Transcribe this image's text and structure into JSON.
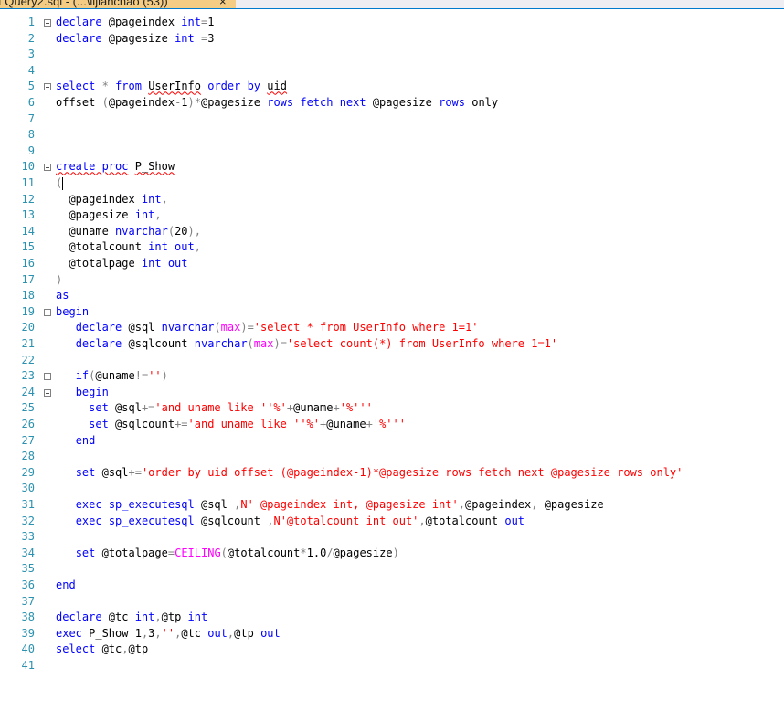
{
  "tab": {
    "title": "LQuery2.sql - (...\\lijianchao (53))",
    "close": "×"
  },
  "lines": [
    {
      "n": "1",
      "fold": true,
      "t": [
        {
          "c": "k",
          "v": "declare"
        },
        {
          "c": "n",
          "v": " @pageindex "
        },
        {
          "c": "k",
          "v": "int"
        },
        {
          "c": "g",
          "v": "="
        },
        {
          "c": "n",
          "v": "1"
        }
      ]
    },
    {
      "n": "2",
      "t": [
        {
          "c": "k",
          "v": "declare"
        },
        {
          "c": "n",
          "v": " @pagesize "
        },
        {
          "c": "k",
          "v": "int"
        },
        {
          "c": "n",
          "v": " "
        },
        {
          "c": "g",
          "v": "="
        },
        {
          "c": "n",
          "v": "3"
        }
      ]
    },
    {
      "n": "3",
      "t": []
    },
    {
      "n": "4",
      "t": []
    },
    {
      "n": "5",
      "fold": true,
      "t": [
        {
          "c": "k",
          "v": "select"
        },
        {
          "c": "n",
          "v": " "
        },
        {
          "c": "g",
          "v": "*"
        },
        {
          "c": "n",
          "v": " "
        },
        {
          "c": "k",
          "v": "from"
        },
        {
          "c": "n",
          "v": " "
        },
        {
          "c": "n squig",
          "v": "UserInfo"
        },
        {
          "c": "n",
          "v": " "
        },
        {
          "c": "k",
          "v": "order by"
        },
        {
          "c": "n",
          "v": " "
        },
        {
          "c": "n squig",
          "v": "uid"
        }
      ]
    },
    {
      "n": "6",
      "t": [
        {
          "c": "n",
          "v": "offset "
        },
        {
          "c": "g",
          "v": "("
        },
        {
          "c": "n",
          "v": "@pageindex"
        },
        {
          "c": "g",
          "v": "-"
        },
        {
          "c": "n",
          "v": "1"
        },
        {
          "c": "g",
          "v": ")*"
        },
        {
          "c": "n",
          "v": "@pagesize "
        },
        {
          "c": "k",
          "v": "rows fetch next"
        },
        {
          "c": "n",
          "v": " @pagesize "
        },
        {
          "c": "k",
          "v": "rows"
        },
        {
          "c": "n",
          "v": " only"
        }
      ]
    },
    {
      "n": "7",
      "t": []
    },
    {
      "n": "8",
      "t": []
    },
    {
      "n": "9",
      "t": []
    },
    {
      "n": "10",
      "fold": true,
      "t": [
        {
          "c": "k squig",
          "v": "create proc"
        },
        {
          "c": "n",
          "v": " "
        },
        {
          "c": "n squig",
          "v": "P_Show"
        }
      ]
    },
    {
      "n": "11",
      "caret": true,
      "t": [
        {
          "c": "g",
          "v": "("
        }
      ]
    },
    {
      "n": "12",
      "t": [
        {
          "c": "n",
          "v": "  @pageindex "
        },
        {
          "c": "k",
          "v": "int"
        },
        {
          "c": "g",
          "v": ","
        }
      ]
    },
    {
      "n": "13",
      "t": [
        {
          "c": "n",
          "v": "  @pagesize "
        },
        {
          "c": "k",
          "v": "int"
        },
        {
          "c": "g",
          "v": ","
        }
      ]
    },
    {
      "n": "14",
      "t": [
        {
          "c": "n",
          "v": "  @uname "
        },
        {
          "c": "k",
          "v": "nvarchar"
        },
        {
          "c": "g",
          "v": "("
        },
        {
          "c": "n",
          "v": "20"
        },
        {
          "c": "g",
          "v": "),"
        }
      ]
    },
    {
      "n": "15",
      "t": [
        {
          "c": "n",
          "v": "  @totalcount "
        },
        {
          "c": "k",
          "v": "int out"
        },
        {
          "c": "g",
          "v": ","
        }
      ]
    },
    {
      "n": "16",
      "t": [
        {
          "c": "n",
          "v": "  @totalpage "
        },
        {
          "c": "k",
          "v": "int out"
        }
      ]
    },
    {
      "n": "17",
      "t": [
        {
          "c": "g",
          "v": ")"
        }
      ]
    },
    {
      "n": "18",
      "t": [
        {
          "c": "k",
          "v": "as"
        }
      ]
    },
    {
      "n": "19",
      "fold": true,
      "t": [
        {
          "c": "k",
          "v": "begin"
        }
      ]
    },
    {
      "n": "20",
      "t": [
        {
          "c": "n",
          "v": "   "
        },
        {
          "c": "k",
          "v": "declare"
        },
        {
          "c": "n",
          "v": " @sql "
        },
        {
          "c": "k",
          "v": "nvarchar"
        },
        {
          "c": "g",
          "v": "("
        },
        {
          "c": "f",
          "v": "max"
        },
        {
          "c": "g",
          "v": ")="
        },
        {
          "c": "s",
          "v": "'select * from UserInfo where 1=1'"
        }
      ]
    },
    {
      "n": "21",
      "t": [
        {
          "c": "n",
          "v": "   "
        },
        {
          "c": "k",
          "v": "declare"
        },
        {
          "c": "n",
          "v": " @sqlcount "
        },
        {
          "c": "k",
          "v": "nvarchar"
        },
        {
          "c": "g",
          "v": "("
        },
        {
          "c": "f",
          "v": "max"
        },
        {
          "c": "g",
          "v": ")="
        },
        {
          "c": "s",
          "v": "'select count(*) from UserInfo where 1=1'"
        }
      ]
    },
    {
      "n": "22",
      "t": []
    },
    {
      "n": "23",
      "fold": true,
      "t": [
        {
          "c": "n",
          "v": "   "
        },
        {
          "c": "k",
          "v": "if"
        },
        {
          "c": "g",
          "v": "("
        },
        {
          "c": "n",
          "v": "@uname"
        },
        {
          "c": "g",
          "v": "!="
        },
        {
          "c": "s",
          "v": "''"
        },
        {
          "c": "g",
          "v": ")"
        }
      ]
    },
    {
      "n": "24",
      "fold": true,
      "t": [
        {
          "c": "n",
          "v": "   "
        },
        {
          "c": "k",
          "v": "begin"
        }
      ]
    },
    {
      "n": "25",
      "t": [
        {
          "c": "n",
          "v": "     "
        },
        {
          "c": "k",
          "v": "set"
        },
        {
          "c": "n",
          "v": " @sql"
        },
        {
          "c": "g",
          "v": "+="
        },
        {
          "c": "s",
          "v": "'and uname like ''%'"
        },
        {
          "c": "g",
          "v": "+"
        },
        {
          "c": "n",
          "v": "@uname"
        },
        {
          "c": "g",
          "v": "+"
        },
        {
          "c": "s",
          "v": "'%'''"
        }
      ]
    },
    {
      "n": "26",
      "t": [
        {
          "c": "n",
          "v": "     "
        },
        {
          "c": "k",
          "v": "set"
        },
        {
          "c": "n",
          "v": " @sqlcount"
        },
        {
          "c": "g",
          "v": "+="
        },
        {
          "c": "s",
          "v": "'and uname like ''%'"
        },
        {
          "c": "g",
          "v": "+"
        },
        {
          "c": "n",
          "v": "@uname"
        },
        {
          "c": "g",
          "v": "+"
        },
        {
          "c": "s",
          "v": "'%'''"
        }
      ]
    },
    {
      "n": "27",
      "t": [
        {
          "c": "n",
          "v": "   "
        },
        {
          "c": "k",
          "v": "end"
        }
      ]
    },
    {
      "n": "28",
      "t": []
    },
    {
      "n": "29",
      "t": [
        {
          "c": "n",
          "v": "   "
        },
        {
          "c": "k",
          "v": "set"
        },
        {
          "c": "n",
          "v": " @sql"
        },
        {
          "c": "g",
          "v": "+="
        },
        {
          "c": "s",
          "v": "'order by uid offset (@pageindex-1)*@pagesize rows fetch next @pagesize rows only'"
        }
      ]
    },
    {
      "n": "30",
      "t": []
    },
    {
      "n": "31",
      "t": [
        {
          "c": "n",
          "v": "   "
        },
        {
          "c": "k",
          "v": "exec"
        },
        {
          "c": "n",
          "v": " "
        },
        {
          "c": "k",
          "v": "sp_executesql"
        },
        {
          "c": "n",
          "v": " @sql "
        },
        {
          "c": "g",
          "v": ","
        },
        {
          "c": "s",
          "v": "N' @pageindex int, @pagesize int'"
        },
        {
          "c": "g",
          "v": ","
        },
        {
          "c": "n",
          "v": "@pageindex"
        },
        {
          "c": "g",
          "v": ","
        },
        {
          "c": "n",
          "v": " @pagesize"
        }
      ]
    },
    {
      "n": "32",
      "t": [
        {
          "c": "n",
          "v": "   "
        },
        {
          "c": "k",
          "v": "exec"
        },
        {
          "c": "n",
          "v": " "
        },
        {
          "c": "k",
          "v": "sp_executesql"
        },
        {
          "c": "n",
          "v": " @sqlcount "
        },
        {
          "c": "g",
          "v": ","
        },
        {
          "c": "s",
          "v": "N'@totalcount int out'"
        },
        {
          "c": "g",
          "v": ","
        },
        {
          "c": "n",
          "v": "@totalcount "
        },
        {
          "c": "k",
          "v": "out"
        }
      ]
    },
    {
      "n": "33",
      "t": []
    },
    {
      "n": "34",
      "t": [
        {
          "c": "n",
          "v": "   "
        },
        {
          "c": "k",
          "v": "set"
        },
        {
          "c": "n",
          "v": " @totalpage"
        },
        {
          "c": "g",
          "v": "="
        },
        {
          "c": "f",
          "v": "CEILING"
        },
        {
          "c": "g",
          "v": "("
        },
        {
          "c": "n",
          "v": "@totalcount"
        },
        {
          "c": "g",
          "v": "*"
        },
        {
          "c": "n",
          "v": "1.0"
        },
        {
          "c": "g",
          "v": "/"
        },
        {
          "c": "n",
          "v": "@pagesize"
        },
        {
          "c": "g",
          "v": ")"
        }
      ]
    },
    {
      "n": "35",
      "t": []
    },
    {
      "n": "36",
      "t": [
        {
          "c": "k",
          "v": "end"
        }
      ]
    },
    {
      "n": "37",
      "t": []
    },
    {
      "n": "38",
      "t": [
        {
          "c": "k",
          "v": "declare"
        },
        {
          "c": "n",
          "v": " @tc "
        },
        {
          "c": "k",
          "v": "int"
        },
        {
          "c": "g",
          "v": ","
        },
        {
          "c": "n",
          "v": "@tp "
        },
        {
          "c": "k",
          "v": "int"
        }
      ]
    },
    {
      "n": "39",
      "t": [
        {
          "c": "k",
          "v": "exec"
        },
        {
          "c": "n",
          "v": " P_Show 1"
        },
        {
          "c": "g",
          "v": ","
        },
        {
          "c": "n",
          "v": "3"
        },
        {
          "c": "g",
          "v": ","
        },
        {
          "c": "s",
          "v": "''"
        },
        {
          "c": "g",
          "v": ","
        },
        {
          "c": "n",
          "v": "@tc "
        },
        {
          "c": "k",
          "v": "out"
        },
        {
          "c": "g",
          "v": ","
        },
        {
          "c": "n",
          "v": "@tp "
        },
        {
          "c": "k",
          "v": "out"
        }
      ]
    },
    {
      "n": "40",
      "t": [
        {
          "c": "k",
          "v": "select"
        },
        {
          "c": "n",
          "v": " @tc"
        },
        {
          "c": "g",
          "v": ","
        },
        {
          "c": "n",
          "v": "@tp"
        }
      ]
    },
    {
      "n": "41",
      "t": []
    }
  ]
}
